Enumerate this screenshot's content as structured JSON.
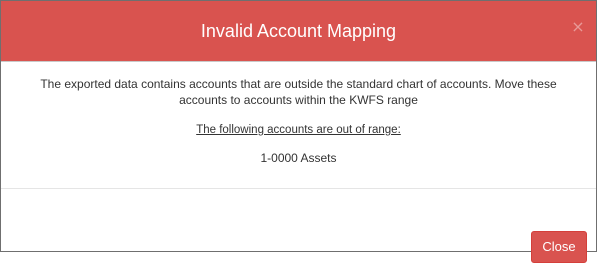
{
  "dialog": {
    "title": "Invalid Account Mapping",
    "close_icon_char": "×",
    "message": "The exported data contains accounts that are outside the standard chart of accounts. Move these accounts to accounts within the KWFS range",
    "subheading": "The following accounts are out of range:",
    "accounts": [
      "1-0000 Assets"
    ],
    "close_button_label": "Close"
  },
  "colors": {
    "header_bg": "#d9534f",
    "button_bg": "#d9534f",
    "text": "#333333"
  },
  "icons": {
    "close": "close-icon"
  }
}
